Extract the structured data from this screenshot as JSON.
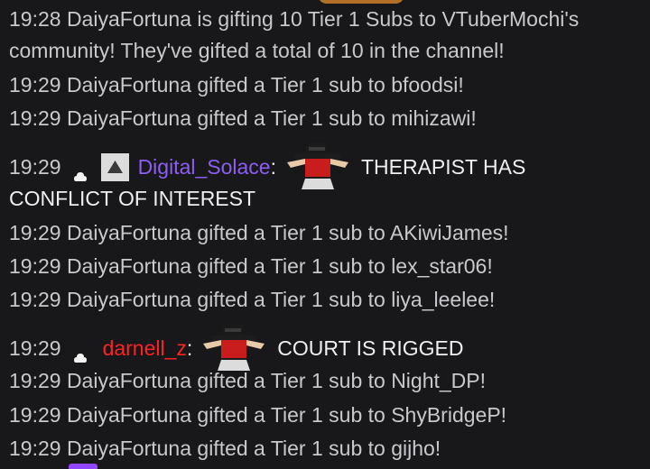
{
  "colors": {
    "background": "#18181b",
    "text": "#efeff1",
    "system_text": "#c9c9cd",
    "digital_solace": "#8c5ef2",
    "darnell_z": "#ff2222"
  },
  "messages": [
    {
      "type": "system",
      "text": "19:28 DaiyaFortuna is gifting 10 Tier 1 Subs to VTuberMochi's"
    },
    {
      "type": "system",
      "text": "community! They've gifted a total of 10 in the channel!"
    },
    {
      "type": "system",
      "text": "19:29 DaiyaFortuna gifted a Tier 1 sub to bfoodsi!"
    },
    {
      "type": "system",
      "text": "19:29 DaiyaFortuna gifted a Tier 1 sub to mihizawi!"
    },
    {
      "type": "chat",
      "time": "19:29",
      "username": "Digital_Solace",
      "colon": ":",
      "text": "THERAPIST HAS",
      "continuation": "CONFLICT OF INTEREST",
      "badges": [
        "bits-badge-icon",
        "subscriber-badge-icon"
      ],
      "emote": "emote-icon"
    },
    {
      "type": "system",
      "text": "19:29 DaiyaFortuna gifted a Tier 1 sub to AKiwiJames!"
    },
    {
      "type": "system",
      "text": "19:29 DaiyaFortuna gifted a Tier 1 sub to lex_star06!"
    },
    {
      "type": "system",
      "text": "19:29 DaiyaFortuna gifted a Tier 1 sub to liya_leelee!"
    },
    {
      "type": "chat",
      "time": "19:29",
      "username": "darnell_z",
      "colon": ":",
      "text": "COURT IS RIGGED",
      "badges": [
        "bits-badge-icon"
      ],
      "emote": "emote-icon"
    },
    {
      "type": "system",
      "text": "19:29 DaiyaFortuna gifted a Tier 1 sub to Night_DP!"
    },
    {
      "type": "system",
      "text": "19:29 DaiyaFortuna gifted a Tier 1 sub to ShyBridgeP!"
    },
    {
      "type": "system",
      "text": "19:29 DaiyaFortuna gifted a Tier 1 sub to gijho!"
    }
  ]
}
